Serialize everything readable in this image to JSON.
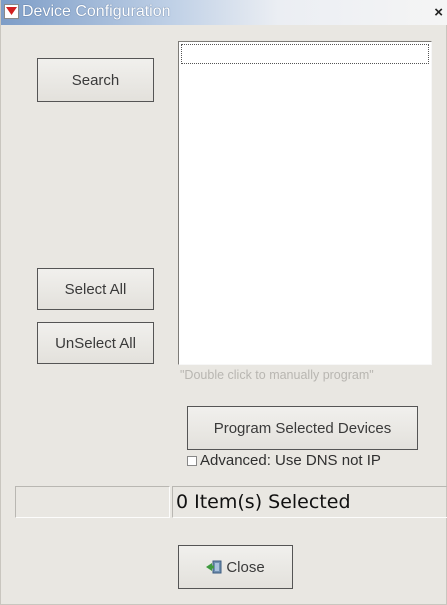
{
  "window": {
    "title": "Device Configuration",
    "close_glyph": "×",
    "icon": "app-icon",
    "colors": {
      "background": "#e9e7e2",
      "title_gradient_start": "#7d9dc7"
    }
  },
  "buttons": {
    "search": "Search",
    "select_all": "Select All",
    "unselect_all": "UnSelect All",
    "program_selected": "Program Selected Devices",
    "close": "Close"
  },
  "device_list": {
    "items": [],
    "hint": "\"Double click to manually program\""
  },
  "options": {
    "advanced_dns_label": "Advanced: Use DNS not IP",
    "advanced_dns_checked": false
  },
  "status": {
    "selected_text": "0 Item(s) Selected"
  }
}
